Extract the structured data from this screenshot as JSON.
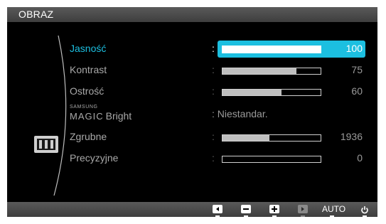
{
  "osd": {
    "title": "OBRAZ",
    "category_icon": "picture-menu-icon",
    "rows": [
      {
        "label": "Jasność",
        "value": 100,
        "selected": true
      },
      {
        "label": "Kontrast",
        "value": 75,
        "selected": false
      },
      {
        "label": "Ostrość",
        "value": 60,
        "selected": false
      },
      {
        "label_small": "SAMSUNG",
        "label_big": "MAGIC",
        "label_rest": "Bright",
        "text_value": ": Niestandar."
      },
      {
        "label": "Zgrubne",
        "value": 1936,
        "max": 4000,
        "selected": false
      },
      {
        "label": "Precyzyjne",
        "value": 0,
        "selected": false
      }
    ],
    "colon": ":",
    "footer": {
      "buttons": [
        {
          "icon": "left-arrow-icon",
          "enabled": true
        },
        {
          "icon": "minus-icon",
          "enabled": true
        },
        {
          "icon": "plus-icon",
          "enabled": true
        },
        {
          "icon": "right-arrow-icon",
          "enabled": false
        }
      ],
      "auto_label": "AUTO",
      "power_icon": "power-icon"
    },
    "colors": {
      "accent": "#1cbfe0",
      "background": "#000000",
      "header": "#4a4a4a"
    }
  }
}
